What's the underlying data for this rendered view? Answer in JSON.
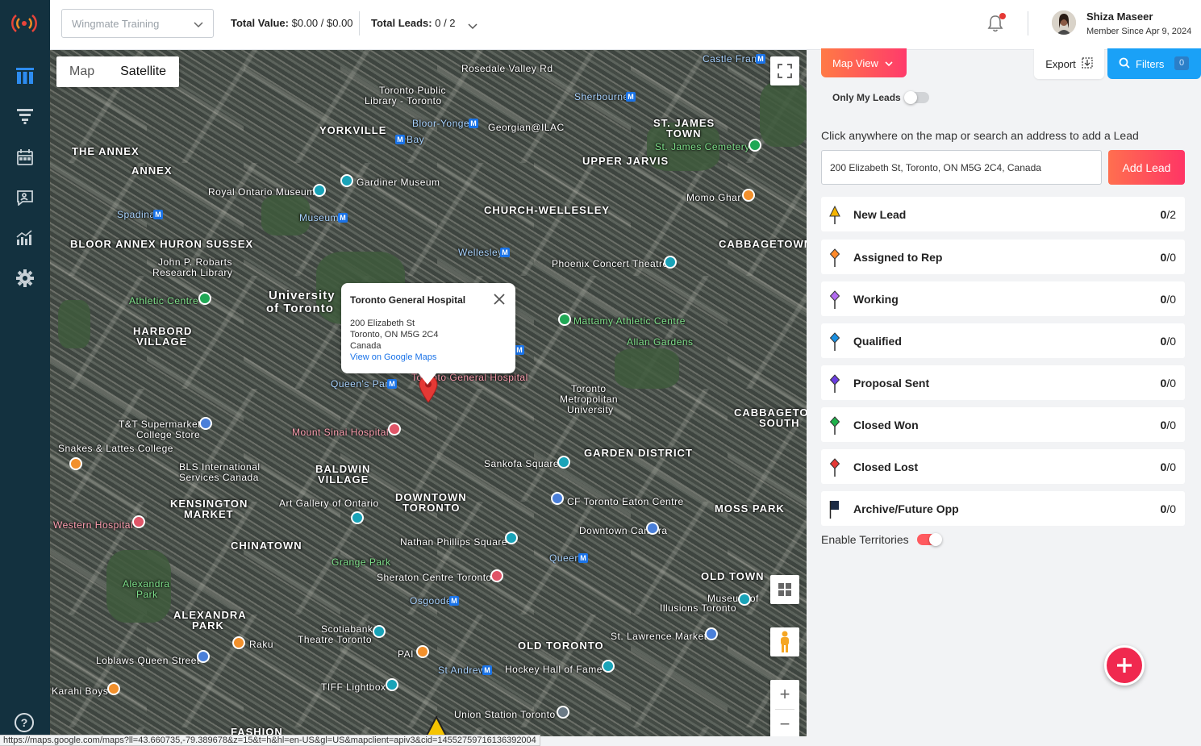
{
  "topbar": {
    "workspace": "Wingmate Training",
    "total_value_label": "Total Value:",
    "total_value": "$0.00 / $0.00",
    "total_leads_label": "Total Leads:",
    "total_leads": "0 / 2",
    "user_name": "Shiza Maseer",
    "user_since": "Member Since Apr 9, 2024"
  },
  "map": {
    "toggle": {
      "map": "Map",
      "satellite": "Satellite"
    },
    "info_window": {
      "title": "Toronto General Hospital",
      "line1": "200 Elizabeth St",
      "line2": "Toronto, ON M5G 2C4",
      "line3": "Canada",
      "link": "View on Google Maps"
    },
    "labels": {
      "yorkville": "YORKVILLE",
      "the_annex": "THE ANNEX",
      "annex": "ANNEX",
      "bloor_annex": "BLOOR ANNEX HURON SUSSEX",
      "church_wellesley": "CHURCH-WELLESLEY",
      "upper_jarvis": "UPPER JARVIS",
      "st_james": "ST. JAMES",
      "town": "TOWN",
      "cabbagetown": "CABBAGETOWN",
      "harbord_village": "HARBORD",
      "village": "VILLAGE",
      "uoft": "University",
      "of_toronto": "of Toronto",
      "baldwin": "BALDWIN",
      "baldwin_village": "VILLAGE",
      "kensington": "KENSINGTON",
      "market": "MARKET",
      "chinatown": "CHINATOWN",
      "downtown": "DOWNTOWN",
      "toronto": "TORONTO",
      "garden_district": "GARDEN DISTRICT",
      "cabbagetown_south": "CABBAGETOWN",
      "south": "SOUTH",
      "moss_park": "MOSS PARK",
      "old_town": "OLD TOWN",
      "old_toronto": "OLD TORONTO",
      "alexandra_park": "ALEXANDRA",
      "park": "PARK",
      "fashion": "FASHION",
      "royal_ontario": "Royal Ontario Museum",
      "gardiner": "Gardiner Museum",
      "toronto_public_library": "Toronto Public",
      "library_toronto": "Library - Toronto",
      "georgian": "Georgian@ILAC",
      "bloor_yonge": "Bloor-Yonge",
      "bay": "Bay",
      "sherbourne": "Sherbourne",
      "castle_frank": "Castle Frank",
      "rosedale_valley": "Rosedale Valley Rd",
      "st_james_cemetery": "St. James Cemetery",
      "momo_ghar": "Momo Ghar",
      "wellesley": "Wellesley",
      "phoenix": "Phoenix Concert Theatre",
      "museum": "Museum",
      "spadina": "Spadina",
      "robarts": "John P. Robarts",
      "research_library": "Research Library",
      "athletic_centre": "Athletic Centre",
      "mattamy": "Mattamy Athletic Centre",
      "allan_gardens": "Allan Gardens",
      "queens_park": "Queen's Park",
      "tgh": "Toronto General Hospital",
      "tmu": "Toronto",
      "tmu2": "Metropolitan",
      "tmu3": "University",
      "mount_sinai": "Mount Sinai Hospital",
      "tt": "T&T Supermarket",
      "college_store": "College Store",
      "snakes": "Snakes & Lattes College",
      "bls": "BLS International",
      "bls2": "Services Canada",
      "sankofa": "Sankofa Square",
      "ago": "Art Gallery of Ontario",
      "eaton": "CF Toronto Eaton Centre",
      "downtown_camera": "Downtown Camera",
      "western": "Western Hospital",
      "nathan": "Nathan Phillips Square",
      "queen": "Queen",
      "grange": "Grange Park",
      "sheraton": "Sheraton Centre Toronto",
      "osgoode": "Osgoode",
      "alexandra_park_g": "Alexandra",
      "park_g": "Park",
      "museum_of_illusions": "Museum of",
      "illusions": "Illusions Toronto",
      "scotiabank": "Scotiabank",
      "theatre_toronto": "Theatre Toronto",
      "raku": "Raku",
      "pai": "PAI",
      "st_lawrence": "St. Lawrence Market",
      "loblaws": "Loblaws Queen Street",
      "st_andrew": "St Andrew",
      "hockey": "Hockey Hall of Fame",
      "karahi": "Karahi Boys",
      "tiff": "TIFF Lightbox",
      "union": "Union Station Toronto"
    },
    "status_url": "https://maps.google.com/maps?ll=43.660735,-79.389678&z=15&t=h&hl=en-US&gl=US&mapclient=apiv3&cid=14552759716136392004"
  },
  "panel": {
    "map_view": "Map View",
    "export": "Export",
    "filters": "Filters",
    "filters_count": "0",
    "only_my_leads": "Only My Leads",
    "instructions": "Click anywhere on the map or search an address to add a Lead",
    "address_value": "200 Elizabeth St, Toronto, ON M5G 2C4, Canada",
    "add_lead": "Add Lead",
    "statuses": [
      {
        "label": "New Lead",
        "count": "0",
        "total": "/2",
        "color": "#f5b400"
      },
      {
        "label": "Assigned to Rep",
        "count": "0",
        "total": "/0",
        "color": "#ff8a2a"
      },
      {
        "label": "Working",
        "count": "0",
        "total": "/0",
        "color": "#b26cf0"
      },
      {
        "label": "Qualified",
        "count": "0",
        "total": "/0",
        "color": "#1a8fe0"
      },
      {
        "label": "Proposal Sent",
        "count": "0",
        "total": "/0",
        "color": "#6a3de0"
      },
      {
        "label": "Closed Won",
        "count": "0",
        "total": "/0",
        "color": "#1fb14a"
      },
      {
        "label": "Closed Lost",
        "count": "0",
        "total": "/0",
        "color": "#e53935"
      },
      {
        "label": "Archive/Future Opp",
        "count": "0",
        "total": "/0",
        "color": "#1b2a44"
      }
    ],
    "enable_territories": "Enable Territories",
    "accent": "#ff3b6b"
  }
}
